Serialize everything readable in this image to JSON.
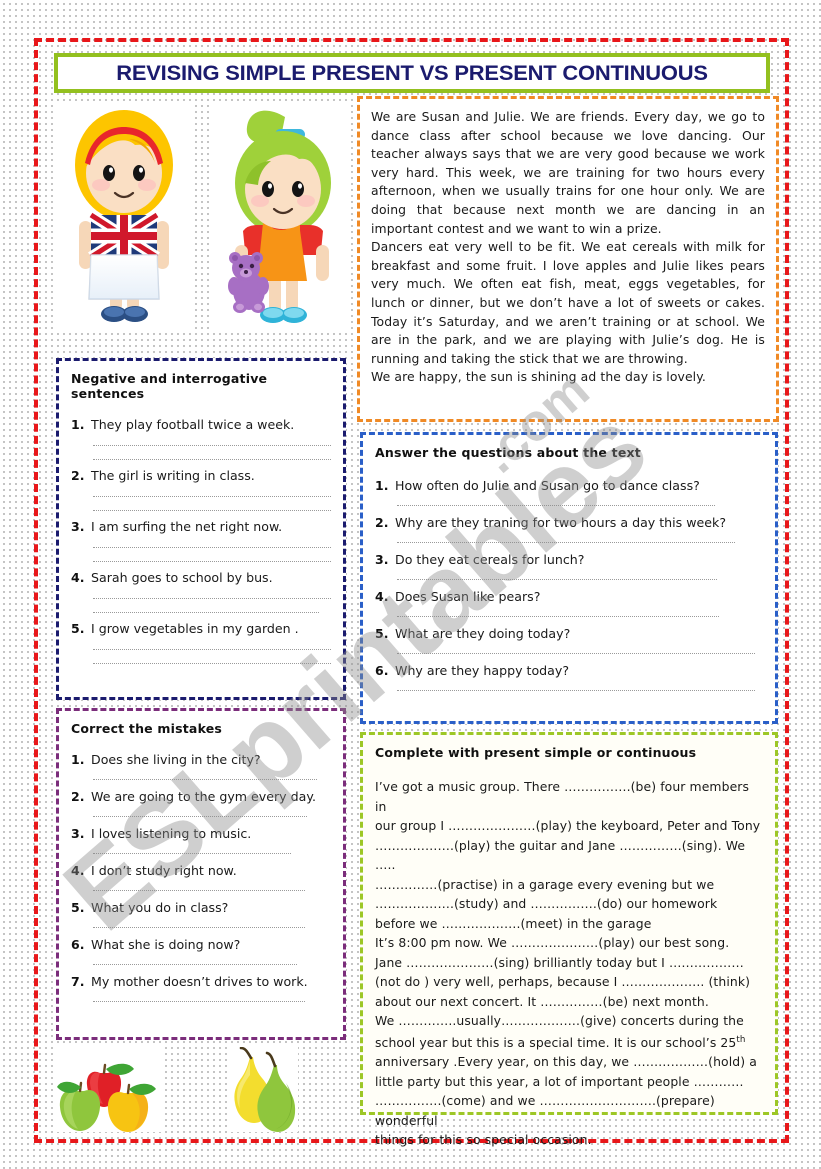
{
  "page": {
    "title": "REVISING SIMPLE PRESENT VS PRESENT CONTINUOUS",
    "watermark_main": "ESLprintables",
    "watermark_sub": ".com",
    "border_color": "#e8171a",
    "title_border_color": "#93c01f",
    "title_text_color": "#1b1b6e"
  },
  "illustrations": {
    "girl_blonde": "blonde-girl-with-union-jack-shirt",
    "girl_green": "green-haired-girl-with-teddy-bear",
    "apples": "apples-clipart",
    "pears": "pears-clipart"
  },
  "reading": {
    "border_color": "#f08a26",
    "paragraphs": [
      "We are Susan and Julie. We are friends. Every day, we go to dance class after school because we love dancing. Our teacher always says that we are very good because we work very hard. This week, we are training for two hours every afternoon, when we usually trains for one hour only. We are doing that because next month we are dancing in an important contest and we want to win a prize.",
      "Dancers eat very well to be fit. We eat cereals with milk for breakfast and some fruit. I love apples and Julie likes pears very much. We often eat fish, meat, eggs vegetables, for lunch or dinner, but we don’t have a lot of sweets or cakes. Today it’s Saturday, and we aren’t training or at school. We are in the park, and we are playing with Julie’s dog. He is running and taking the stick that we are throwing.",
      "We are happy, the sun is shining ad the day is lovely."
    ]
  },
  "negative_section": {
    "border_color": "#1b1b6e",
    "title": "Negative and interrogative sentences",
    "items": [
      {
        "num": "1.",
        "text": "They play football twice a week."
      },
      {
        "num": "2.",
        "text": "The girl is writing in class."
      },
      {
        "num": "3.",
        "text": "I am surfing the net right now."
      },
      {
        "num": "4.",
        "text": "Sarah goes to school by bus."
      },
      {
        "num": "5.",
        "text": "I grow vegetables in my garden ."
      }
    ]
  },
  "mistakes_section": {
    "border_color": "#7b2d7b",
    "title": "Correct the mistakes",
    "items": [
      {
        "num": "1.",
        "text": "Does she living in the city?"
      },
      {
        "num": "2.",
        "text": "We are going to the gym every day."
      },
      {
        "num": "3.",
        "text": "I loves listening to music."
      },
      {
        "num": "4.",
        "text": "I don’t study right now."
      },
      {
        "num": "5.",
        "text": "What you do in class?"
      },
      {
        "num": "6.",
        "text": "What she is doing now?"
      },
      {
        "num": "7.",
        "text": "My mother doesn’t drives to work."
      }
    ]
  },
  "questions_section": {
    "border_color": "#2a5fc8",
    "title": "Answer the questions about the text",
    "items": [
      {
        "num": "1.",
        "text": "How often do Julie and Susan go to dance class?"
      },
      {
        "num": "2.",
        "text": "Why are they traning for two hours a day this week?"
      },
      {
        "num": "3.",
        "text": "Do they eat cereals for lunch?"
      },
      {
        "num": "4.",
        "text": "Does Susan like pears?"
      },
      {
        "num": "5.",
        "text": "What are they doing today?"
      },
      {
        "num": "6.",
        "text": "Why are they happy today?"
      }
    ]
  },
  "complete_section": {
    "border_color": "#9dc726",
    "title": "Complete with present simple or continuous",
    "lines": [
      "I’ve got a music group. There …………….(be) four members in",
      "our group I …………………(play) the keyboard, Peter and Tony",
      "……………….(play) the guitar and Jane ……………(sing). We …..",
      "……………(practise) in a garage every evening but we",
      "……………….(study) and …………….(do) our homework",
      "before we ……………….(meet) in the garage",
      "It’s 8:00 pm now. We …………………(play) our best song.",
      "Jane …………………(sing) brilliantly today but I ………………",
      "(not do ) very well, perhaps, because I ……………….. (think)",
      "about our next concert. It ……………(be) next month.",
      "We …………..usually……………….(give) concerts during the",
      "school year but this is a special time. It is our school’s  25th",
      "anniversary .Every year, on this day, we ………………(hold) a",
      "little party but this year, a lot of important people …………",
      "…………….(come) and we ……………………….(prepare) wonderful",
      "things for this so special occasion."
    ],
    "superscript_line_index": 11,
    "superscript_number": "25",
    "superscript_suffix": "th"
  }
}
